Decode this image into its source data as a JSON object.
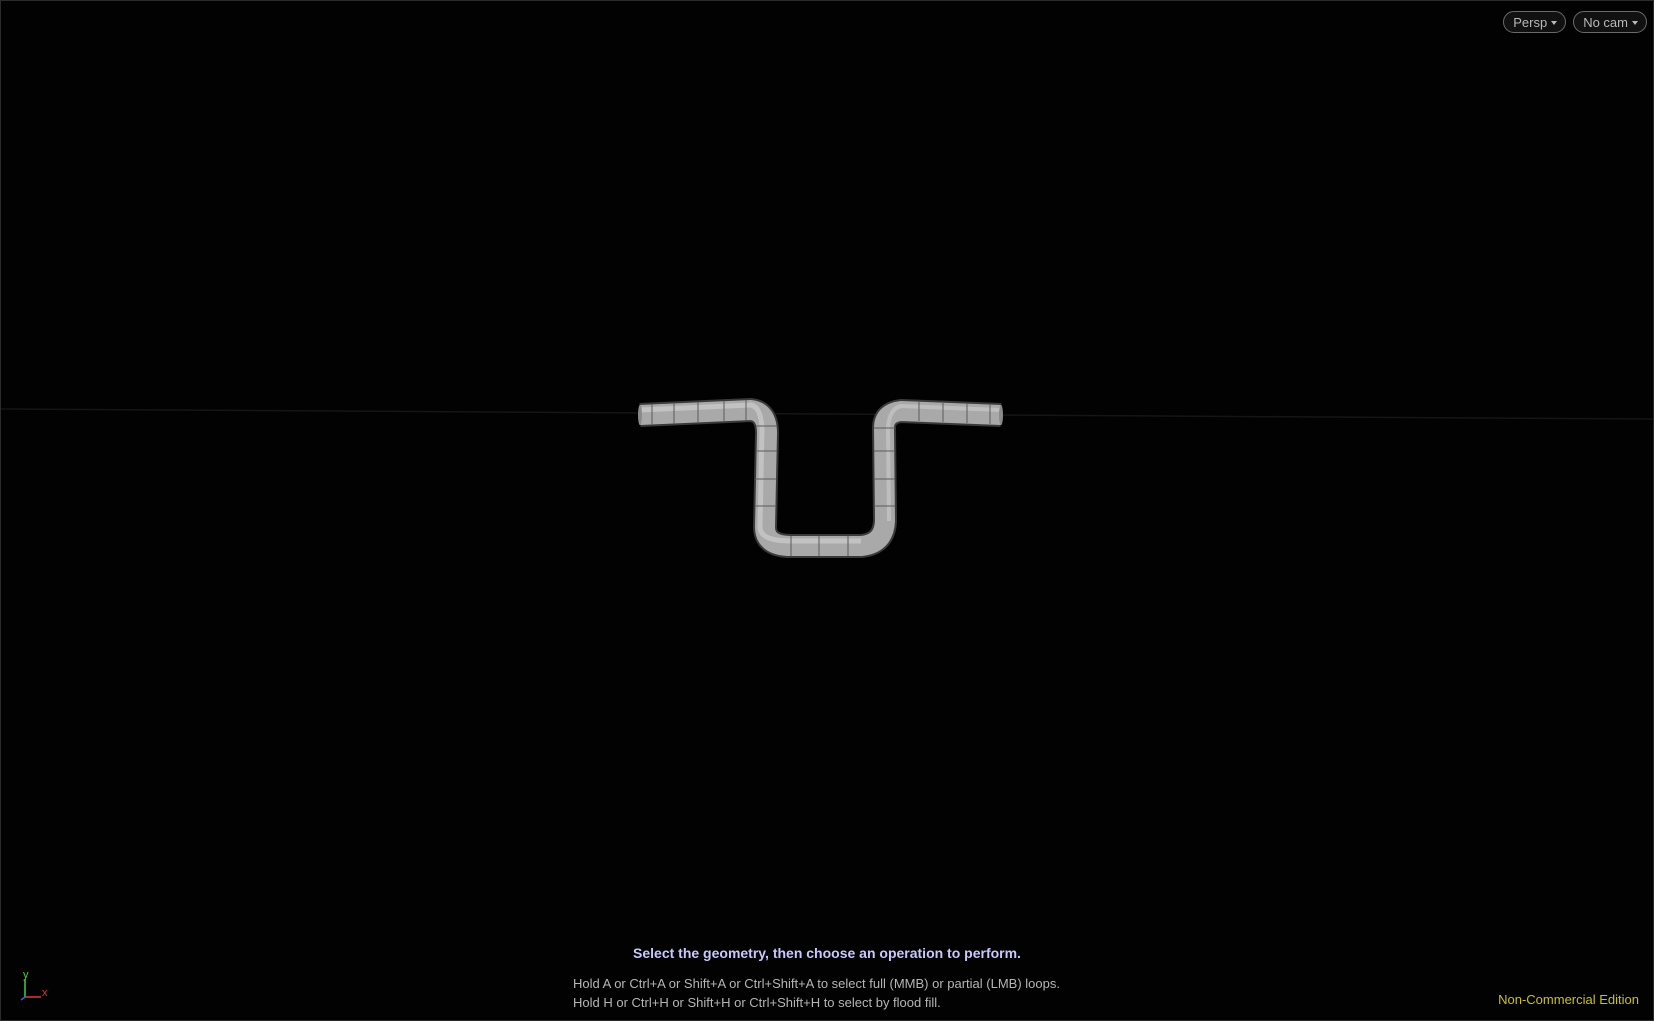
{
  "viewport": {
    "camera_mode_label": "Persp",
    "camera_select_label": "No cam",
    "prompt_title": "Select the geometry, then choose an operation to perform.",
    "hint_line_1": "Hold A or Ctrl+A or Shift+A or Ctrl+Shift+A to select full (MMB) or partial (LMB) loops.",
    "hint_line_2": "Hold H or Ctrl+H or Shift+H or Ctrl+Shift+H to select by flood fill.",
    "edition_label": "Non-Commercial Edition",
    "axis": {
      "y_label": "y",
      "x_label": "x"
    }
  },
  "icons": [
    "chevron-down-icon",
    "axis-gizmo-icon"
  ],
  "colors": {
    "background": "#020202",
    "prompt_text": "#c8c8ff",
    "edition_text": "#c9c020",
    "geometry_fill": "#a9a9a9",
    "axis_x": "#e03a3a",
    "axis_y": "#3fcf3f",
    "axis_z": "#3a5fe0"
  }
}
